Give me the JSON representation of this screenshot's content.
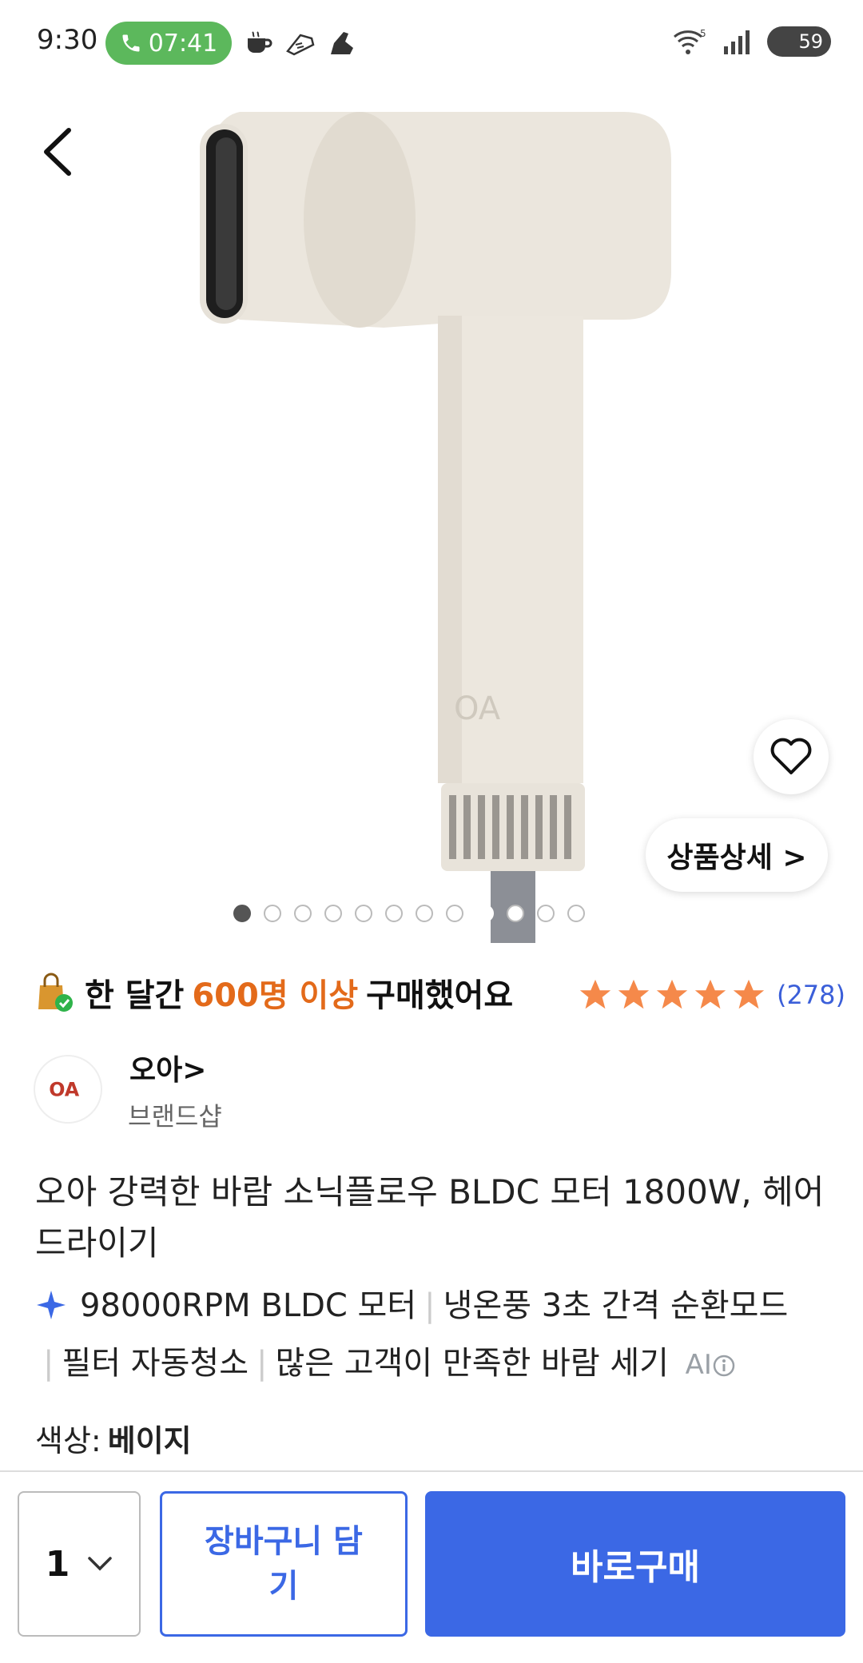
{
  "status_bar": {
    "time": "9:30",
    "call_timer": "07:41",
    "battery": "59"
  },
  "product_image": {
    "carousel_total": 12,
    "carousel_active": 1,
    "carousel_highlight": 9,
    "detail_label": "상품상세 >"
  },
  "purchase_info": {
    "prefix": "한 달간",
    "highlight": "600명 이상",
    "suffix": "구매했어요",
    "rating_stars": 5,
    "review_count": "(278)"
  },
  "brand": {
    "name": "오아>",
    "subtitle": "브랜드샵",
    "logo_text": "OA"
  },
  "product": {
    "title": "오아 강력한 바람 소닉플로우 BLDC 모터 1800W, 헤어 드라이기",
    "features": [
      "98000RPM BLDC 모터",
      "냉온풍 3초 간격 순환모드",
      "필터 자동청소",
      "많은 고객이 만족한 바람 세기"
    ],
    "ai_label": "AI",
    "color_label": "색상:",
    "color_value": "베이지"
  },
  "bottom_bar": {
    "quantity": "1",
    "cart_label": "장바구니 담기",
    "buy_label": "바로구매"
  },
  "colors": {
    "accent_blue": "#3b68e5",
    "highlight_orange": "#e36a1a",
    "star_orange": "#f5894a",
    "call_green": "#5cb85c"
  }
}
